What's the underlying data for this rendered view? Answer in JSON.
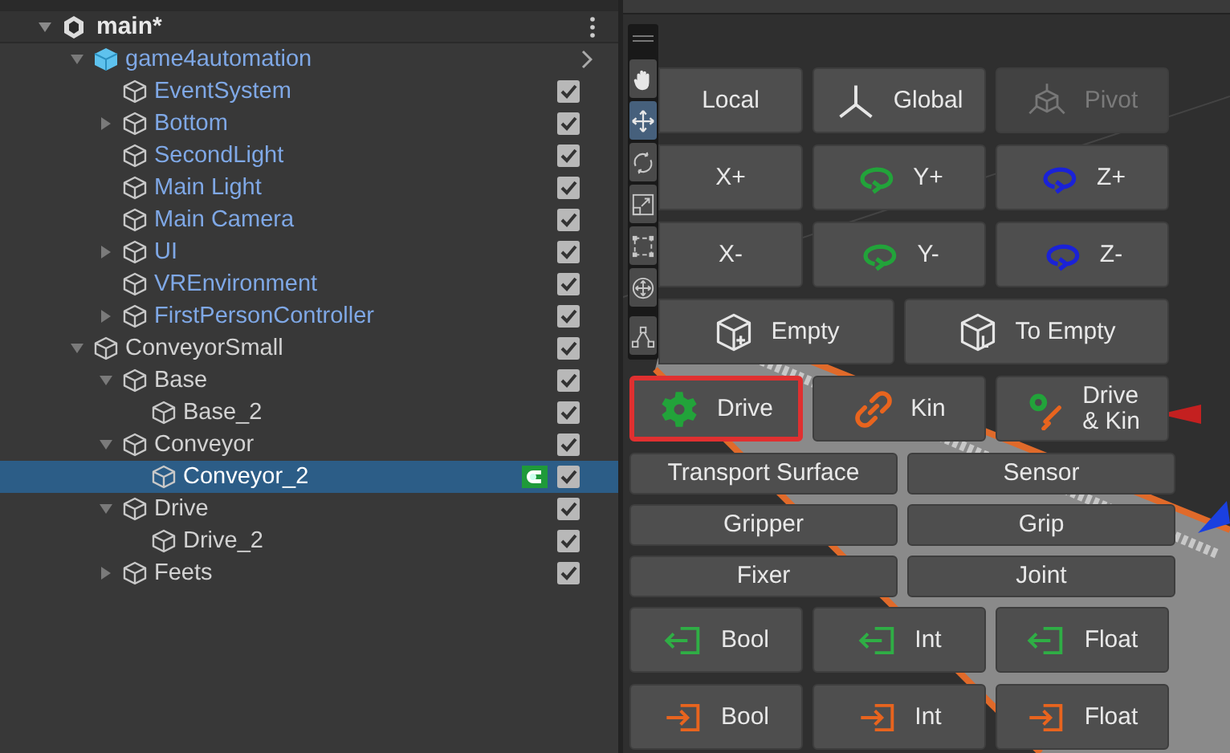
{
  "hierarchy": {
    "scene": {
      "name": "main*",
      "expanded": true,
      "children": [
        {
          "name": "game4automation",
          "kind": "prefab",
          "expanded": true,
          "selected": false,
          "children": [
            {
              "name": "EventSystem",
              "kind": "prefab-child",
              "selected": false,
              "visible": true
            },
            {
              "name": "Bottom",
              "kind": "prefab-child",
              "expanded": false,
              "selected": false,
              "visible": true
            },
            {
              "name": "SecondLight",
              "kind": "prefab-child",
              "selected": false,
              "visible": true
            },
            {
              "name": "Main Light",
              "kind": "prefab-child",
              "selected": false,
              "visible": true
            },
            {
              "name": "Main Camera",
              "kind": "prefab-child",
              "selected": false,
              "visible": true
            },
            {
              "name": "UI",
              "kind": "prefab-child",
              "expanded": false,
              "selected": false,
              "visible": true
            },
            {
              "name": "VREnvironment",
              "kind": "prefab-child",
              "selected": false,
              "visible": true
            },
            {
              "name": "FirstPersonController",
              "kind": "prefab-child",
              "expanded": false,
              "selected": false,
              "visible": true
            }
          ]
        },
        {
          "name": "ConveyorSmall",
          "kind": "object",
          "expanded": true,
          "selected": false,
          "visible": true,
          "children": [
            {
              "name": "Base",
              "kind": "object",
              "expanded": true,
              "selected": false,
              "visible": true,
              "children": [
                {
                  "name": "Base_2",
                  "kind": "object",
                  "selected": false,
                  "visible": true
                }
              ]
            },
            {
              "name": "Conveyor",
              "kind": "object",
              "expanded": true,
              "selected": false,
              "visible": true,
              "children": [
                {
                  "name": "Conveyor_2",
                  "kind": "object",
                  "selected": true,
                  "visible": true,
                  "badge": true
                }
              ]
            },
            {
              "name": "Drive",
              "kind": "object",
              "expanded": true,
              "selected": false,
              "visible": true,
              "children": [
                {
                  "name": "Drive_2",
                  "kind": "object",
                  "selected": false,
                  "visible": true
                }
              ]
            },
            {
              "name": "Feets",
              "kind": "object",
              "expanded": false,
              "selected": false,
              "visible": true
            }
          ]
        }
      ]
    }
  },
  "scene_view": {
    "tools": [
      {
        "kind": "hand",
        "selected": false
      },
      {
        "kind": "move",
        "selected": true
      },
      {
        "kind": "rotate",
        "selected": false
      },
      {
        "kind": "scale",
        "selected": false
      },
      {
        "kind": "rect",
        "selected": false
      },
      {
        "kind": "transform",
        "selected": false
      },
      {
        "kind": "custom",
        "selected": false
      }
    ],
    "button_rows": [
      {
        "kind": "icon",
        "buttons": [
          {
            "label": "Local",
            "selected": false,
            "disabled": false
          },
          {
            "label": "Global",
            "kind": "axes",
            "selected": false,
            "disabled": false
          },
          {
            "label": "Pivot",
            "kind": "pivot",
            "selected": false,
            "disabled": true
          }
        ]
      },
      {
        "kind": "icon",
        "buttons": [
          {
            "label": "X+",
            "selected": false,
            "disabled": false
          },
          {
            "label": "Y+",
            "kind": "rotate",
            "color": "#22a33a",
            "selected": false,
            "disabled": false
          },
          {
            "label": "Z+",
            "kind": "rotate",
            "color": "#1a22d8",
            "selected": false,
            "disabled": false
          }
        ]
      },
      {
        "kind": "icon",
        "buttons": [
          {
            "label": "X-",
            "selected": false,
            "disabled": false
          },
          {
            "label": "Y-",
            "kind": "rotate",
            "color": "#22a33a",
            "selected": false,
            "disabled": false
          },
          {
            "label": "Z-",
            "kind": "rotate",
            "color": "#1a22d8",
            "selected": false,
            "disabled": false
          }
        ]
      },
      {
        "kind": "icon",
        "buttons": [
          {
            "label": "Empty",
            "kind": "cube-plus",
            "selected": false,
            "disabled": false
          },
          {
            "label": "To Empty",
            "kind": "cube-to",
            "selected": false,
            "disabled": false
          }
        ]
      },
      {
        "kind": "icon",
        "buttons": [
          {
            "label": "Drive",
            "kind": "gear",
            "selected": true,
            "disabled": false
          },
          {
            "label": "Kin",
            "kind": "chain",
            "selected": false,
            "disabled": false
          },
          {
            "label": "Drive\n& Kin",
            "kind": "gear-chain",
            "selected": false,
            "disabled": false
          }
        ]
      },
      {
        "kind": "text",
        "buttons": [
          {
            "label": "Transport Surface",
            "selected": false,
            "disabled": false
          },
          {
            "label": "Sensor",
            "selected": false,
            "disabled": false
          }
        ]
      },
      {
        "kind": "text",
        "buttons": [
          {
            "label": "Gripper",
            "selected": false,
            "disabled": false
          },
          {
            "label": "Grip",
            "selected": false,
            "disabled": false
          }
        ]
      },
      {
        "kind": "text",
        "buttons": [
          {
            "label": "Fixer",
            "selected": false,
            "disabled": false
          },
          {
            "label": "Joint",
            "selected": false,
            "disabled": false
          }
        ]
      },
      {
        "kind": "icon",
        "buttons": [
          {
            "label": "Bool",
            "kind": "signal-in",
            "color": "#2fae45",
            "selected": false,
            "disabled": false
          },
          {
            "label": "Int",
            "kind": "signal-in",
            "color": "#2fae45",
            "selected": false,
            "disabled": false
          },
          {
            "label": "Float",
            "kind": "signal-in",
            "color": "#2fae45",
            "selected": false,
            "disabled": false
          }
        ]
      },
      {
        "kind": "icon",
        "buttons": [
          {
            "label": "Bool",
            "kind": "signal-out",
            "color": "#e8641e",
            "selected": false,
            "disabled": false
          },
          {
            "label": "Int",
            "kind": "signal-out",
            "color": "#e8641e",
            "selected": false,
            "disabled": false
          },
          {
            "label": "Float",
            "kind": "signal-out",
            "color": "#e8641e",
            "selected": false,
            "disabled": false
          }
        ]
      }
    ]
  }
}
